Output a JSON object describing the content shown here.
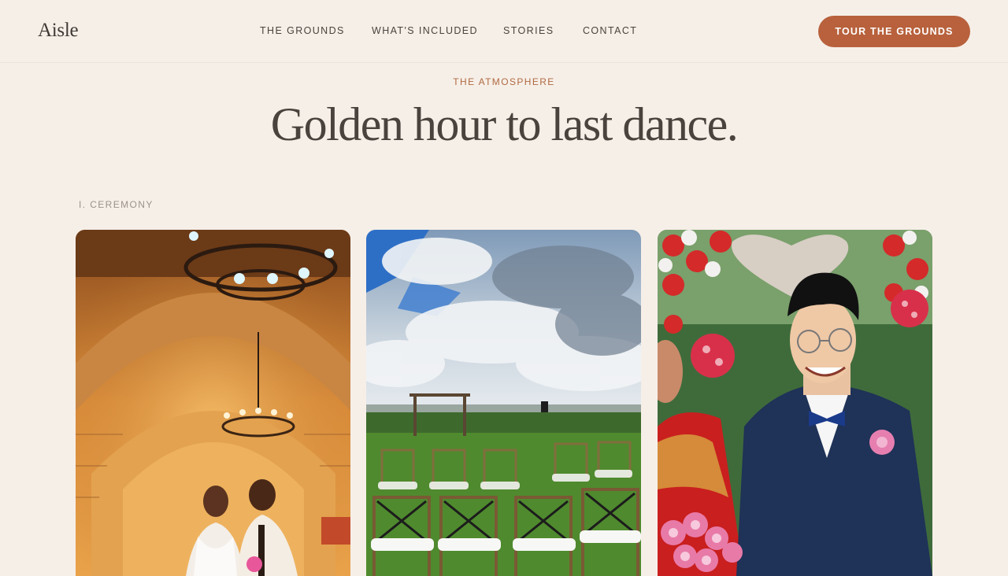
{
  "brand": {
    "logo_text": "Aisle"
  },
  "nav": {
    "items": [
      {
        "label": "THE GROUNDS"
      },
      {
        "label": "WHAT'S INCLUDED"
      },
      {
        "label": "STORIES"
      },
      {
        "label": "CONTACT"
      }
    ],
    "cta_label": "TOUR THE GROUNDS"
  },
  "hero": {
    "eyebrow": "THE ATMOSPHERE",
    "headline": "Golden hour to last dance."
  },
  "section": {
    "label": "I. CEREMONY",
    "photos": [
      {
        "subject": "couple under chandelier in stone arch hall"
      },
      {
        "subject": "outdoor ceremony chairs under cloudy sky"
      },
      {
        "subject": "smiling groom in navy suit with bride"
      }
    ]
  },
  "colors": {
    "background": "#f6efe8",
    "accent": "#b8613c",
    "eyebrow": "#b06a42",
    "text": "#4a433d"
  }
}
